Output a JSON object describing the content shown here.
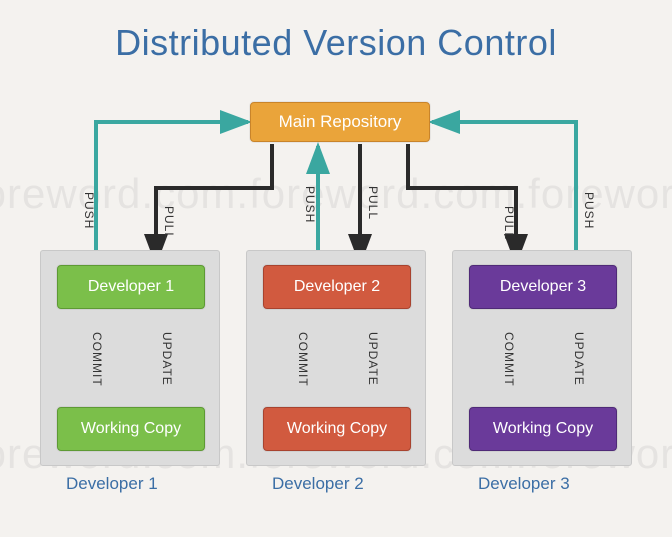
{
  "title": "Distributed Version Control",
  "main_repo": "Main Repository",
  "watermark": "foreword.com.foreword.com.foreword",
  "arrow_labels": {
    "push": "PUSH",
    "pull": "PULL",
    "commit": "COMMIT",
    "update": "UPDATE"
  },
  "developers": [
    {
      "name": "Developer 1",
      "working_copy": "Working Copy",
      "caption": "Developer 1"
    },
    {
      "name": "Developer 2",
      "working_copy": "Working Copy",
      "caption": "Developer 2"
    },
    {
      "name": "Developer 3",
      "working_copy": "Working Copy",
      "caption": "Developer 3"
    }
  ],
  "colors": {
    "title": "#3b6ea5",
    "main_repo": "#eaa43a",
    "dev1": "#7bbf4a",
    "dev2": "#d15a3f",
    "dev3": "#6a3a9a",
    "panel": "#dcdcdc",
    "teal_arrow": "#3aa7a0",
    "lilac_arrow": "#b8a9e6",
    "black_arrow": "#2a2a2a"
  },
  "diagram": {
    "type": "flow",
    "nodes": [
      "Main Repository",
      "Developer 1",
      "Developer 2",
      "Developer 3",
      "Working Copy 1",
      "Working Copy 2",
      "Working Copy 3"
    ],
    "edges": [
      {
        "from": "Developer 1",
        "to": "Main Repository",
        "label": "PUSH"
      },
      {
        "from": "Main Repository",
        "to": "Developer 1",
        "label": "PULL"
      },
      {
        "from": "Developer 2",
        "to": "Main Repository",
        "label": "PUSH"
      },
      {
        "from": "Main Repository",
        "to": "Developer 2",
        "label": "PULL"
      },
      {
        "from": "Developer 3",
        "to": "Main Repository",
        "label": "PUSH"
      },
      {
        "from": "Main Repository",
        "to": "Developer 3",
        "label": "PULL"
      },
      {
        "from": "Working Copy 1",
        "to": "Developer 1",
        "label": "COMMIT"
      },
      {
        "from": "Developer 1",
        "to": "Working Copy 1",
        "label": "UPDATE"
      },
      {
        "from": "Working Copy 2",
        "to": "Developer 2",
        "label": "COMMIT"
      },
      {
        "from": "Developer 2",
        "to": "Working Copy 2",
        "label": "UPDATE"
      },
      {
        "from": "Working Copy 3",
        "to": "Developer 3",
        "label": "COMMIT"
      },
      {
        "from": "Developer 3",
        "to": "Working Copy 3",
        "label": "UPDATE"
      }
    ]
  }
}
